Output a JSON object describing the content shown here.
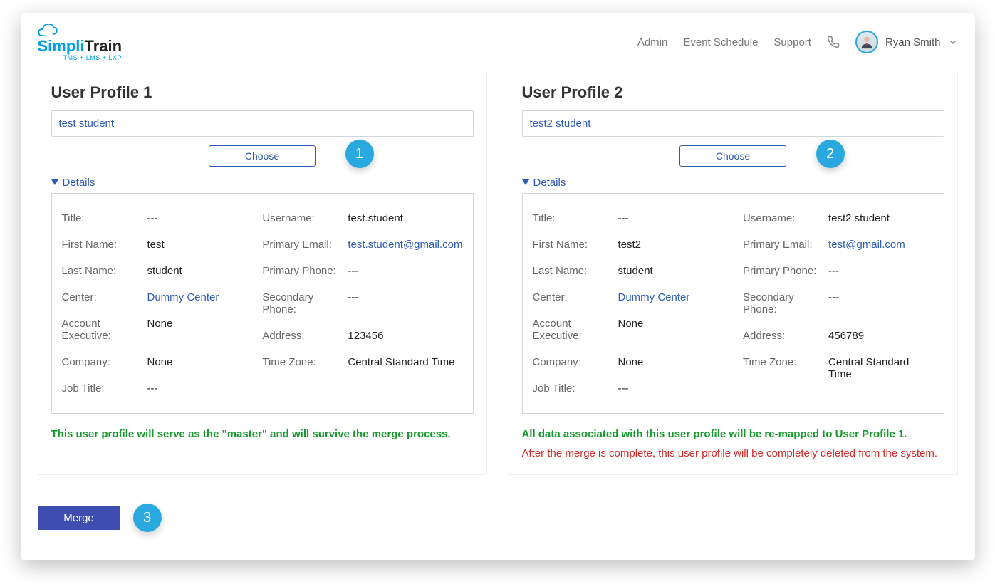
{
  "header": {
    "logo_primary": "Simpli",
    "logo_secondary": "Train",
    "logo_tagline": "TMS + LMS + LXP",
    "nav": {
      "admin": "Admin",
      "event_schedule": "Event Schedule",
      "support": "Support"
    },
    "user_name": "Ryan Smith"
  },
  "profiles": [
    {
      "title": "User Profile 1",
      "search_value": "test student",
      "choose_label": "Choose",
      "step_number": "1",
      "details_label": "Details",
      "left": {
        "title": {
          "label": "Title:",
          "value": "---"
        },
        "first_name": {
          "label": "First Name:",
          "value": "test"
        },
        "last_name": {
          "label": "Last Name:",
          "value": "student"
        },
        "center": {
          "label": "Center:",
          "value": "Dummy Center",
          "link": true
        },
        "account_exec": {
          "label": "Account Executive:",
          "value": "None"
        },
        "company": {
          "label": "Company:",
          "value": "None"
        },
        "job_title": {
          "label": "Job Title:",
          "value": "---"
        }
      },
      "right": {
        "username": {
          "label": "Username:",
          "value": "test.student"
        },
        "primary_email": {
          "label": "Primary Email:",
          "value": "test.student@gmail.com",
          "link": true
        },
        "primary_phone": {
          "label": "Primary Phone:",
          "value": "---"
        },
        "secondary_phone": {
          "label": "Secondary Phone:",
          "value": "---"
        },
        "address": {
          "label": "Address:",
          "value": "123456"
        },
        "time_zone": {
          "label": "Time Zone:",
          "value": "Central Standard Time"
        }
      },
      "note_green": "This user profile will serve as the \"master\" and will survive the merge process.",
      "note_red": ""
    },
    {
      "title": "User Profile 2",
      "search_value": "test2 student",
      "choose_label": "Choose",
      "step_number": "2",
      "details_label": "Details",
      "left": {
        "title": {
          "label": "Title:",
          "value": "---"
        },
        "first_name": {
          "label": "First Name:",
          "value": "test2"
        },
        "last_name": {
          "label": "Last Name:",
          "value": "student"
        },
        "center": {
          "label": "Center:",
          "value": "Dummy Center",
          "link": true
        },
        "account_exec": {
          "label": "Account Executive:",
          "value": "None"
        },
        "company": {
          "label": "Company:",
          "value": "None"
        },
        "job_title": {
          "label": "Job Title:",
          "value": "---"
        }
      },
      "right": {
        "username": {
          "label": "Username:",
          "value": "test2.student"
        },
        "primary_email": {
          "label": "Primary Email:",
          "value": "test@gmail.com",
          "link": true
        },
        "primary_phone": {
          "label": "Primary Phone:",
          "value": "---"
        },
        "secondary_phone": {
          "label": "Secondary Phone:",
          "value": "---"
        },
        "address": {
          "label": "Address:",
          "value": "456789"
        },
        "time_zone": {
          "label": "Time Zone:",
          "value": "Central Standard Time"
        }
      },
      "note_green": "All data associated with this user profile will be re-mapped to User Profile 1.",
      "note_red": "After the merge is complete, this user profile will be completely deleted from the system."
    }
  ],
  "merge": {
    "label": "Merge",
    "step_number": "3"
  }
}
